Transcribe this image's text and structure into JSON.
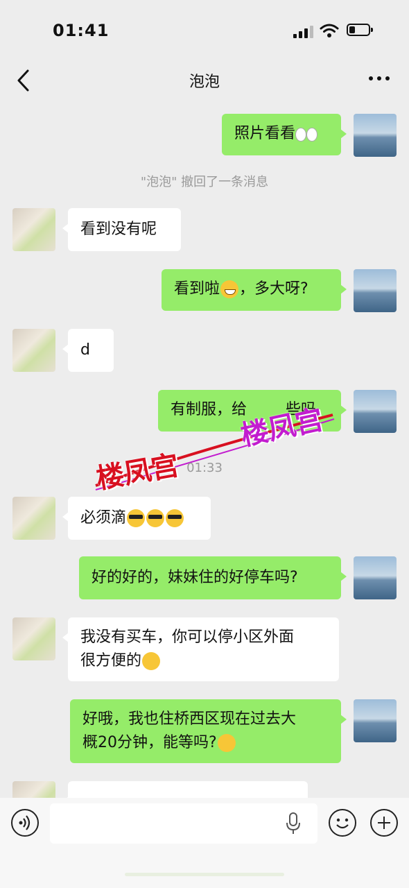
{
  "status_bar": {
    "time": "01:41"
  },
  "header": {
    "title": "泡泡"
  },
  "messages": [
    {
      "side": "mine",
      "text": "照片看看"
    },
    {
      "side": "system",
      "text": "\"泡泡\" 撤回了一条消息"
    },
    {
      "side": "other",
      "text": "看到没有呢"
    },
    {
      "side": "mine",
      "text_before": "看到啦",
      "text_after": "，多大呀?"
    },
    {
      "side": "other",
      "text": "d"
    },
    {
      "side": "mine",
      "text": "有制服，给",
      "text_tail": "些吗"
    },
    {
      "side": "system",
      "text": "01:33"
    },
    {
      "side": "other",
      "text": "必须滴"
    },
    {
      "side": "mine",
      "text": "好的好的，妹妹住的好停车吗?"
    },
    {
      "side": "other",
      "line1": "我没有买车，你可以停小区外面",
      "line2": "很方便的"
    },
    {
      "side": "mine",
      "line1": "好哦，我也住桥西区现在过去大",
      "line2": "概20分钟，能等吗?"
    }
  ],
  "watermarks": {
    "mark1": "楼凤宫",
    "mark2": "楼凤宫"
  },
  "input_bar": {
    "placeholder": ""
  }
}
